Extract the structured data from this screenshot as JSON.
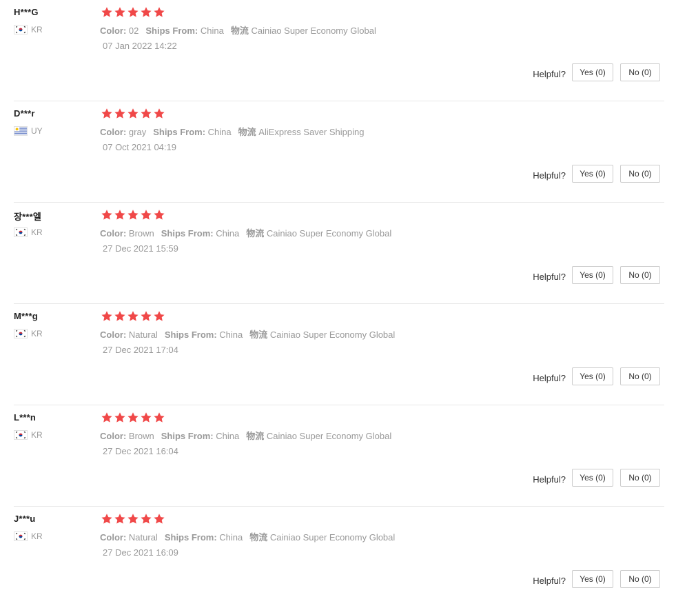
{
  "colors": {
    "star": "#f04848",
    "muted_text": "#999999",
    "divider": "#e8e8e8",
    "button_border": "#cccccc"
  },
  "helpful_label": "Helpful?",
  "reviews": [
    {
      "user": "H***G",
      "country": "KR",
      "flag": "korea-flag-icon",
      "rating": 5,
      "sku": [
        {
          "key": "Color:",
          "value": "02"
        },
        {
          "key": "Ships From:",
          "value": "China"
        },
        {
          "key": "物流",
          "value": "Cainiao Super Economy Global"
        }
      ],
      "date": "07 Jan 2022 14:22",
      "yes_label": "Yes (0)",
      "no_label": "No (0)"
    },
    {
      "user": "D***r",
      "country": "UY",
      "flag": "uruguay-flag-icon",
      "rating": 5,
      "sku": [
        {
          "key": "Color:",
          "value": "gray"
        },
        {
          "key": "Ships From:",
          "value": "China"
        },
        {
          "key": "物流",
          "value": "AliExpress Saver Shipping"
        }
      ],
      "date": "07 Oct 2021 04:19",
      "yes_label": "Yes (0)",
      "no_label": "No (0)"
    },
    {
      "user": "장***엘",
      "country": "KR",
      "flag": "korea-flag-icon",
      "rating": 5,
      "sku": [
        {
          "key": "Color:",
          "value": "Brown"
        },
        {
          "key": "Ships From:",
          "value": "China"
        },
        {
          "key": "物流",
          "value": "Cainiao Super Economy Global"
        }
      ],
      "date": "27 Dec 2021 15:59",
      "yes_label": "Yes (0)",
      "no_label": "No (0)"
    },
    {
      "user": "M***g",
      "country": "KR",
      "flag": "korea-flag-icon",
      "rating": 5,
      "sku": [
        {
          "key": "Color:",
          "value": "Natural"
        },
        {
          "key": "Ships From:",
          "value": "China"
        },
        {
          "key": "物流",
          "value": "Cainiao Super Economy Global"
        }
      ],
      "date": "27 Dec 2021 17:04",
      "yes_label": "Yes (0)",
      "no_label": "No (0)"
    },
    {
      "user": "L***n",
      "country": "KR",
      "flag": "korea-flag-icon",
      "rating": 5,
      "sku": [
        {
          "key": "Color:",
          "value": "Brown"
        },
        {
          "key": "Ships From:",
          "value": "China"
        },
        {
          "key": "物流",
          "value": "Cainiao Super Economy Global"
        }
      ],
      "date": "27 Dec 2021 16:04",
      "yes_label": "Yes (0)",
      "no_label": "No (0)"
    },
    {
      "user": "J***u",
      "country": "KR",
      "flag": "korea-flag-icon",
      "rating": 5,
      "sku": [
        {
          "key": "Color:",
          "value": "Natural"
        },
        {
          "key": "Ships From:",
          "value": "China"
        },
        {
          "key": "物流",
          "value": "Cainiao Super Economy Global"
        }
      ],
      "date": "27 Dec 2021 16:09",
      "yes_label": "Yes (0)",
      "no_label": "No (0)"
    }
  ]
}
